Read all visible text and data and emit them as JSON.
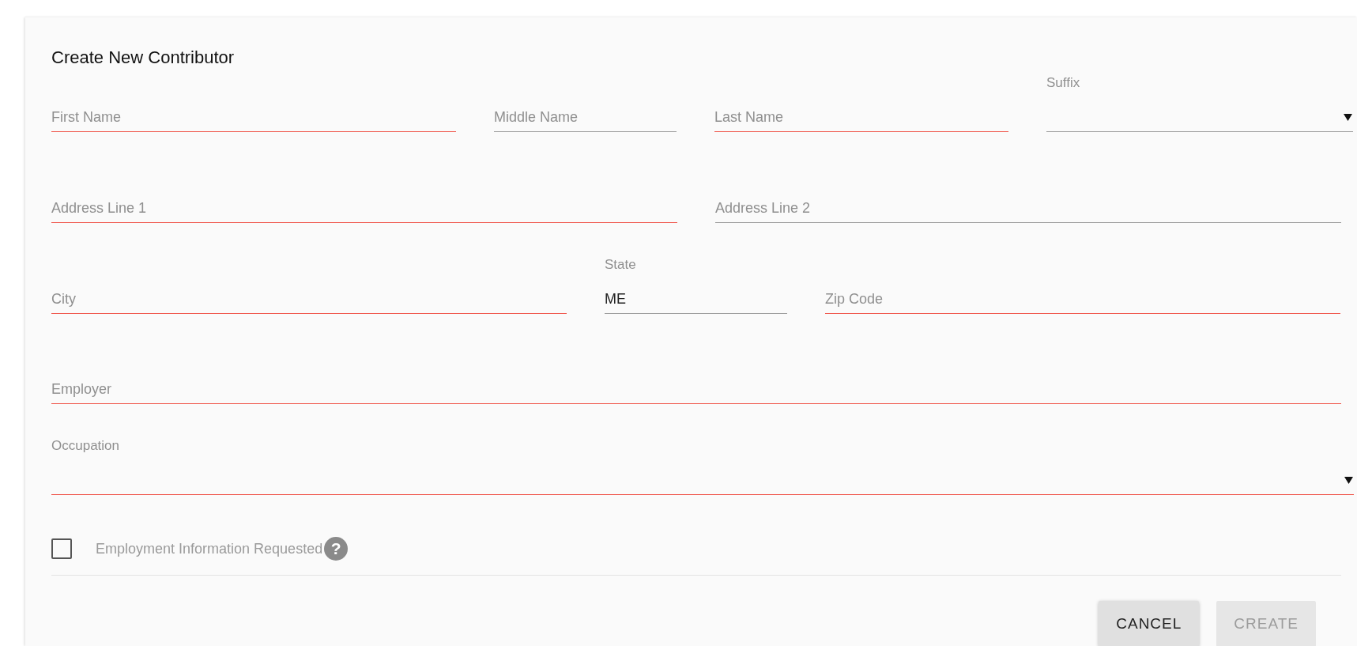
{
  "dialog": {
    "title": "Create New Contributor"
  },
  "rows": [
    [
      {
        "kind": "text",
        "placeholder": "First Name",
        "invalid": true
      },
      {
        "kind": "text",
        "placeholder": "Middle Name",
        "invalid": false
      },
      {
        "kind": "text",
        "placeholder": "Last Name",
        "invalid": true
      },
      {
        "kind": "select",
        "label": "Suffix",
        "invalid": false
      }
    ],
    [
      {
        "kind": "text",
        "placeholder": "Address Line 1",
        "invalid": true
      },
      {
        "kind": "text",
        "placeholder": "Address Line 2",
        "invalid": false
      }
    ],
    [
      {
        "kind": "text",
        "placeholder": "City",
        "invalid": true
      },
      {
        "kind": "text",
        "label": "State",
        "value": "ME",
        "invalid": false
      },
      {
        "kind": "text",
        "placeholder": "Zip Code",
        "invalid": true
      }
    ],
    [
      {
        "kind": "text",
        "placeholder": "Employer",
        "invalid": true
      }
    ],
    [
      {
        "kind": "select",
        "label": "Occupation",
        "invalid": true
      }
    ]
  ],
  "checkbox": {
    "label": "Employment Information Requested",
    "checked": false,
    "help": "?"
  },
  "buttons": [
    {
      "label": "CANCEL",
      "disabled": false
    },
    {
      "label": "CREATE",
      "disabled": true
    }
  ]
}
